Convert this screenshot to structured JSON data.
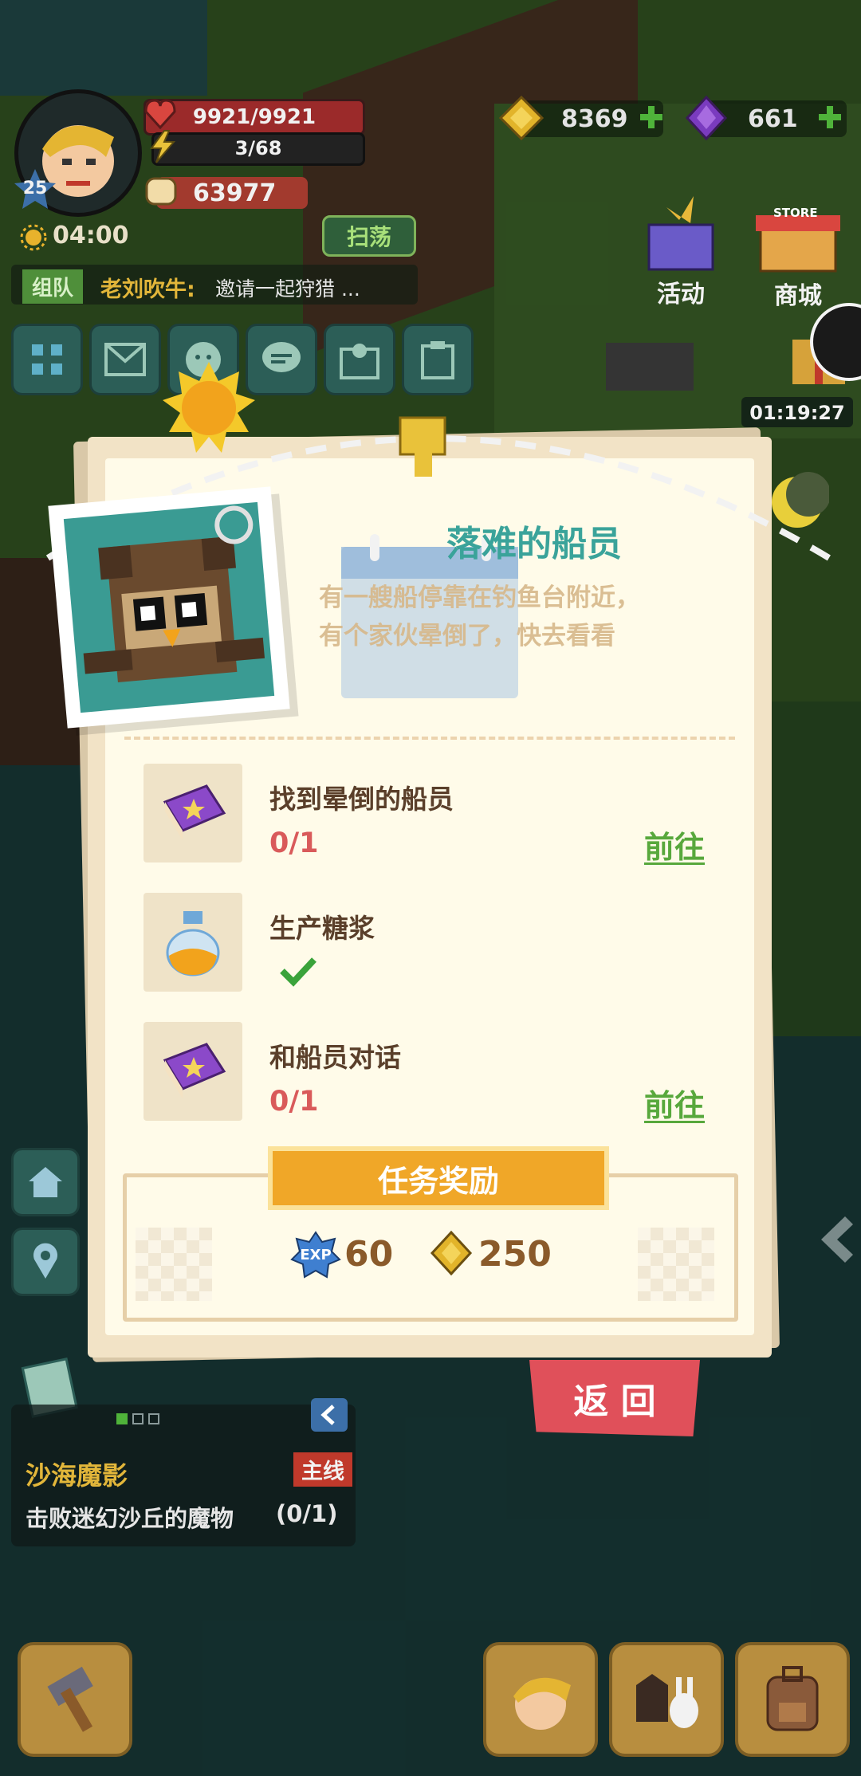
{
  "player": {
    "level": "25",
    "hp": "9921/9921",
    "stamina": "3/68",
    "power": "63977",
    "timer": "04:00"
  },
  "currency": {
    "gold": "8369",
    "gems": "661"
  },
  "hud": {
    "sweep_label": "扫荡",
    "team_tag": "组队",
    "chat_sender": "老刘吹牛:",
    "chat_message": "邀请一起狩猎 ...",
    "activity_label": "活动",
    "shop_label": "商城",
    "shop_sign": "STORE",
    "event_timer": "01:19:27"
  },
  "quest_panel": {
    "title": "落难的船员",
    "description_line1": "有一艘船停靠在钓鱼台附近，",
    "description_line2": "有个家伙晕倒了，快去看看",
    "tasks": [
      {
        "name": "找到晕倒的船员",
        "progress": "0/1",
        "action": "前往",
        "icon": "purple-book-icon"
      },
      {
        "name": "生产糖浆",
        "progress": "",
        "action": "",
        "icon": "syrup-bottle-icon",
        "completed": true
      },
      {
        "name": "和船员对话",
        "progress": "0/1",
        "action": "前往",
        "icon": "purple-book-icon"
      }
    ],
    "reward_title": "任务奖励",
    "reward_exp_tag": "EXP",
    "reward_exp": "60",
    "reward_gold": "250",
    "back_label": "返 回"
  },
  "main_quest": {
    "title": "沙海魔影",
    "tag": "主线",
    "objective": "击败迷幻沙丘的魔物",
    "progress": "(0/1)"
  },
  "colors": {
    "title_teal": "#3aa39a",
    "progress_red": "#d95a5a",
    "goto_green": "#58a83c",
    "reward_orange": "#f0a728",
    "back_red": "#e0505a"
  }
}
